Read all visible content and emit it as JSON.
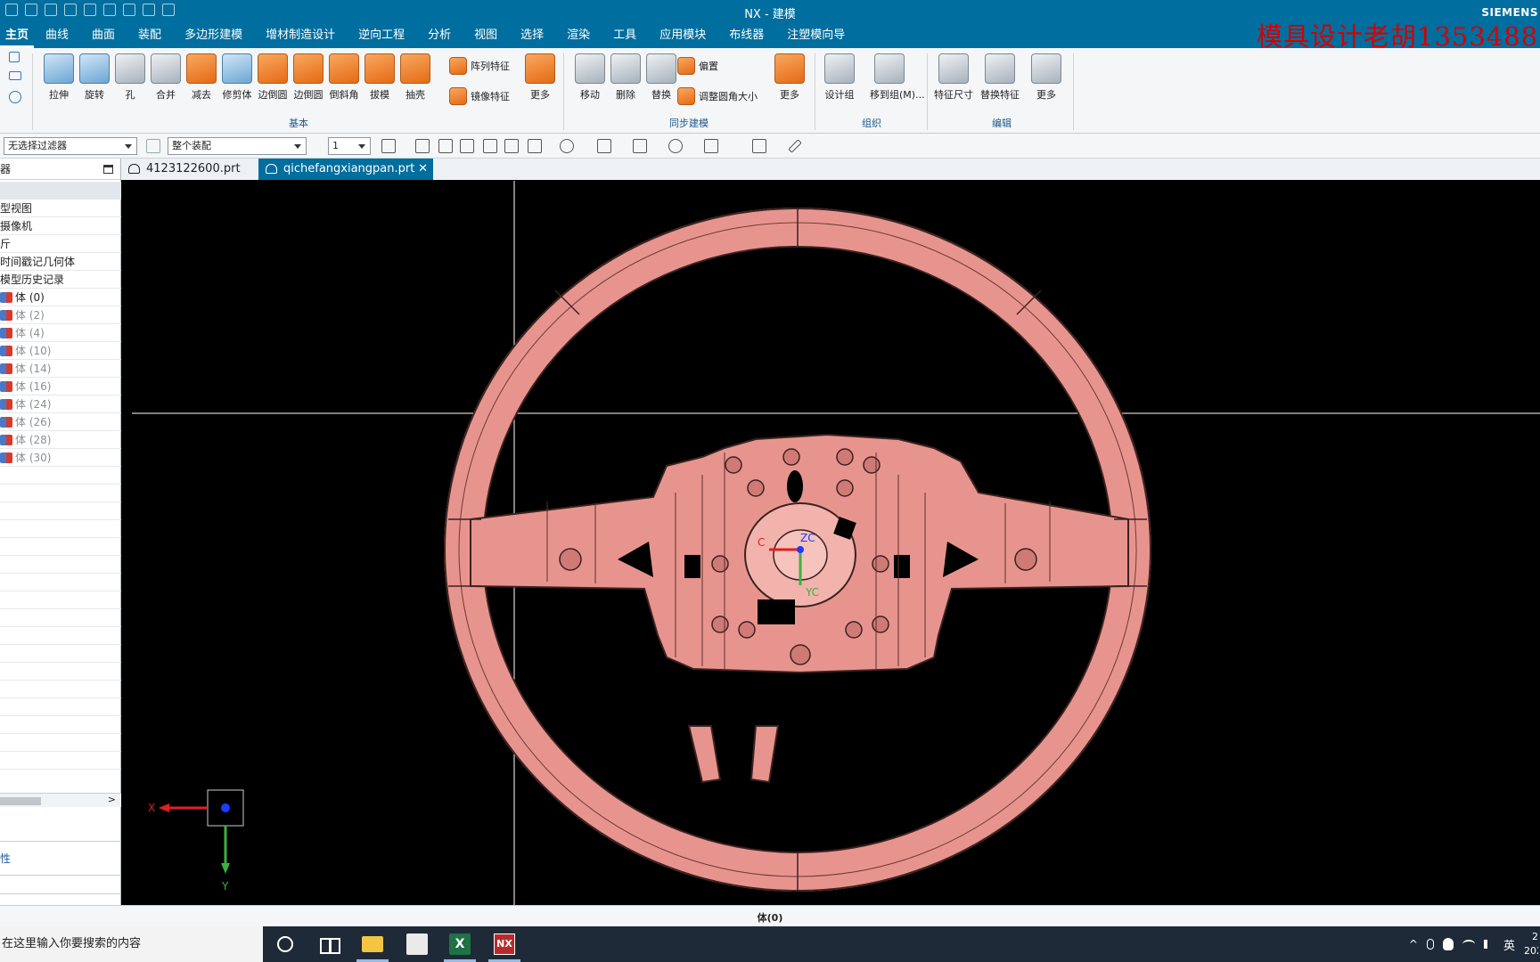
{
  "window": {
    "title": "NX - 建模",
    "brand": "SIEMENS"
  },
  "watermark": "模具设计老胡1353488",
  "menu": [
    "主页",
    "曲线",
    "曲面",
    "装配",
    "多边形建模",
    "增材制造设计",
    "逆向工程",
    "分析",
    "视图",
    "选择",
    "渲染",
    "工具",
    "应用模块",
    "布线器",
    "注塑模向导"
  ],
  "ribbon": {
    "basic": {
      "label": "基本",
      "tools": [
        "拉伸",
        "旋转",
        "孔",
        "合并",
        "减去",
        "修剪体",
        "边倒圆",
        "边倒圆",
        "倒斜角",
        "拔模",
        "抽壳"
      ],
      "small": [
        "阵列特征",
        "镜像特征"
      ],
      "more": "更多"
    },
    "sync": {
      "label": "同步建模",
      "tools": [
        "移动",
        "删除",
        "替换"
      ],
      "small": [
        "偏置",
        "调整圆角大小"
      ],
      "more": "更多"
    },
    "organize": {
      "label": "组织",
      "tools": [
        "设计组",
        "移到组(M)..."
      ]
    },
    "edit": {
      "label": "编辑",
      "tools": [
        "特征尺寸",
        "替换特征",
        "更多"
      ]
    }
  },
  "toolbar": {
    "filter": "无选择过滤器",
    "scope": "整个装配",
    "layer": "1"
  },
  "tabs": [
    {
      "name": "4123122600.prt",
      "active": false
    },
    {
      "name": "qichefangxiangpan.prt",
      "active": true
    }
  ],
  "navigator": {
    "header": "器",
    "rows": [
      {
        "label": "",
        "type": "hdr"
      },
      {
        "label": "型视图",
        "type": "plain"
      },
      {
        "label": "摄像机",
        "type": "plain"
      },
      {
        "label": "斤",
        "type": "plain"
      },
      {
        "label": "时间戳记几何体",
        "type": "plain"
      },
      {
        "label": "模型历史记录",
        "type": "plain"
      },
      {
        "label": "体 (0)",
        "type": "body"
      },
      {
        "label": "体 (2)",
        "type": "bodydim"
      },
      {
        "label": "体 (4)",
        "type": "bodydim"
      },
      {
        "label": "体 (10)",
        "type": "bodydim"
      },
      {
        "label": "体 (14)",
        "type": "bodydim"
      },
      {
        "label": "体 (16)",
        "type": "bodydim"
      },
      {
        "label": "体 (24)",
        "type": "bodydim"
      },
      {
        "label": "体 (26)",
        "type": "bodydim"
      },
      {
        "label": "体 (28)",
        "type": "bodydim"
      },
      {
        "label": "体 (30)",
        "type": "bodydim"
      }
    ],
    "lower": "性"
  },
  "viewport": {
    "triad": {
      "x": "X",
      "y": "Y"
    },
    "wcs": {
      "xc": "C",
      "yc": "YC",
      "zc": "ZC"
    },
    "model_color": "#e8948e"
  },
  "status": "体(0)",
  "taskbar": {
    "search_placeholder": "在这里输入你要搜索的内容",
    "ime": "英",
    "clock_time": "2",
    "clock_date": "202"
  },
  "colors": {
    "accent": "#006e9e",
    "watermark": "#d60000"
  }
}
